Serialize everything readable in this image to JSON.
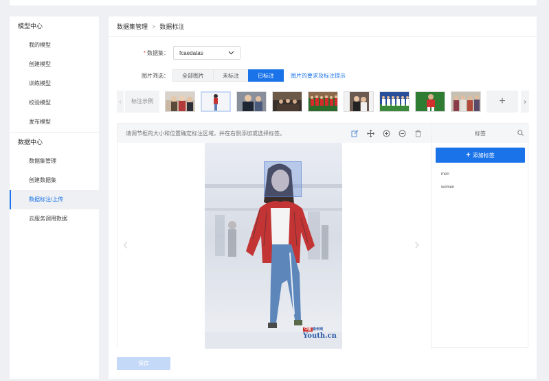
{
  "sidebar": {
    "groups": [
      {
        "title": "模型中心",
        "items": [
          "我的模型",
          "创建模型",
          "训练模型",
          "校验模型",
          "发布模型"
        ]
      },
      {
        "title": "数据中心",
        "items": [
          "数据集管理",
          "创建数据集",
          "数据标注/上传",
          "云服务调用数据"
        ]
      }
    ],
    "active_item": "数据标注/上传"
  },
  "breadcrumb": {
    "parent": "数据集管理",
    "separator": ">",
    "current": "数据标注"
  },
  "dataset": {
    "label": "数据集：",
    "required_mark": "*",
    "value": "fcaedatas"
  },
  "filter": {
    "label": "图片筛选：",
    "options": [
      "全部图片",
      "未标注",
      "已标注"
    ],
    "selected": "已标注",
    "help_link": "图片的要求及标注提示"
  },
  "thumbnails": {
    "sample_label": "标注示例",
    "count": 10,
    "selected_index": 1,
    "add_symbol": "+"
  },
  "workspace": {
    "hint": "请调节框的大小和位置确定标注区域，并在右侧添加或选择标签。",
    "tools": [
      "edit-icon",
      "move-icon",
      "zoom-in-icon",
      "zoom-out-icon",
      "delete-icon"
    ]
  },
  "image_watermark": {
    "tag": "中国",
    "tag2": "青年网",
    "text": "Youth.cn"
  },
  "labels": {
    "header": "标签",
    "add_button": "添加标签",
    "items": [
      "men",
      "women"
    ]
  },
  "save_button": "保存",
  "colors": {
    "accent": "#1a73e8",
    "save_disabled": "#c4d9f7",
    "bbox": "#648cdc"
  }
}
